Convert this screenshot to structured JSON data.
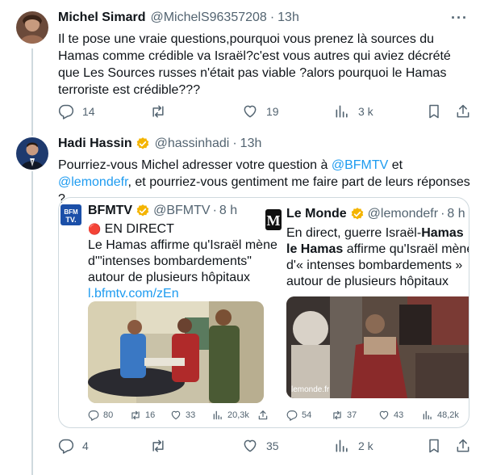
{
  "tweet1": {
    "name": "Michel Simard",
    "handle": "@MichelS96357208",
    "dot": "·",
    "time": "13h",
    "more": "···",
    "text": "Il te pose une vraie questions,pourquoi vous prenez là sources du Hamas comme crédible va Israël?c'est vous autres qui aviez décrété que Les Sources russes n'était pas viable ?alors pourquoi le Hamas terroriste est crédible???",
    "replies": "14",
    "retweets": "",
    "likes": "19",
    "views": "3 k"
  },
  "tweet2": {
    "name": "Hadi Hassin",
    "handle": "@hassinhadi",
    "dot": "·",
    "time": "13h",
    "text_part1": "Pourriez-vous Michel adresser votre question à ",
    "mention1": "@BFMTV",
    "text_part2": " et ",
    "mention2": "@lemondefr",
    "text_part3": ", et pourriez-vous gentiment me faire part de leurs réponses ?",
    "replies": "4",
    "retweets": "",
    "likes": "35",
    "views": "2 k",
    "colors": {
      "verified": "#f4b400",
      "link": "#1d9bf0"
    }
  },
  "quote_bfm": {
    "name": "BFMTV",
    "handle": "@BFMTV",
    "dot": "·",
    "time": "8 h",
    "logo_text": "BFM TV.",
    "line1_emoji": "🔴",
    "line1": "EN DIRECT",
    "line2": "Le Hamas affirme qu'Israël mène",
    "line3": "d'\"intenses bombardements\"",
    "line4": "autour de plusieurs hôpitaux",
    "link": "l.bfmtv.com/zEn",
    "replies": "80",
    "retweets": "16",
    "likes": "33",
    "views": "20,3k"
  },
  "quote_lemonde": {
    "name": "Le Monde",
    "handle": "@lemondefr",
    "dot": "·",
    "time": "8 h",
    "logo_text": "M",
    "line1": "En direct, guerre Israël-",
    "line1_bold": "Hamas",
    "line2_bold": "le Hamas",
    "line2": " affirme qu'Israël mène",
    "line3": "d'« intenses bombardements »",
    "line4": "autour de plusieurs hôpitaux",
    "watermark": "lemonde.fr",
    "replies": "54",
    "retweets": "37",
    "likes": "43",
    "views": "48,2k"
  }
}
